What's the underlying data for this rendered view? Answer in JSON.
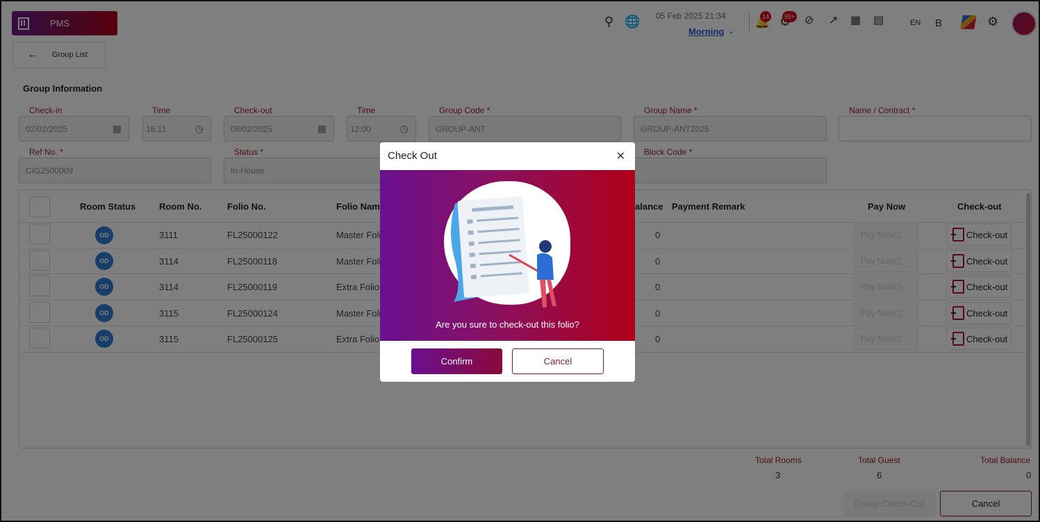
{
  "app": {
    "name": "PMS"
  },
  "header": {
    "date_time": "05 Feb 2025  21:34",
    "shift": "Morning",
    "notifications_count": "14",
    "alerts_count": "99+",
    "language": "EN",
    "b_label": "B"
  },
  "nav": {
    "back_label": "Group List"
  },
  "group_info": {
    "title": "Group Information",
    "checkin_label": "Check-in",
    "checkin_value": "02/02/2025",
    "checkin_time_label": "Time",
    "checkin_time_value": "16:11",
    "checkout_label": "Check-out",
    "checkout_value": "06/02/2025",
    "checkout_time_label": "Time",
    "checkout_time_value": "12:00",
    "group_code_label": "Group Code *",
    "group_code_value": "GROUP-ANT",
    "group_name_label": "Group Name *",
    "group_name_value": "GROUP-ANT2025",
    "name_contract_label": "Name / Contract *",
    "name_contract_value": "",
    "ref_no_label": "Ref No. *",
    "ref_no_value": "CIG2500009",
    "status_label": "Status *",
    "status_value": "In-House",
    "block_code_label": "Block Code *",
    "block_code_value": ""
  },
  "table": {
    "headers": {
      "room_status": "Room Status",
      "room_no": "Room No.",
      "folio_no": "Folio No.",
      "folio_name": "Folio Nam",
      "balance": "alance",
      "payment_remark": "Payment Remark",
      "pay_now": "Pay Now",
      "check_out": "Check-out"
    },
    "rows": [
      {
        "status": "OD",
        "room": "3111",
        "folio": "FL25000122",
        "name": "Master Foli",
        "balance": "0"
      },
      {
        "status": "OD",
        "room": "3114",
        "folio": "FL25000118",
        "name": "Master Foli",
        "balance": "0"
      },
      {
        "status": "OD",
        "room": "3114",
        "folio": "FL25000119",
        "name": "Extra Folio",
        "balance": "0"
      },
      {
        "status": "OD",
        "room": "3115",
        "folio": "FL25000124",
        "name": "Master Foli",
        "balance": "0"
      },
      {
        "status": "OD",
        "room": "3115",
        "folio": "FL25000125",
        "name": "Extra Folio",
        "balance": "0"
      }
    ],
    "pay_now_label": "Pay Now",
    "check_out_label": "Check-out"
  },
  "totals": {
    "rooms_label": "Total Rooms",
    "rooms_value": "3",
    "guest_label": "Total Guest",
    "guest_value": "6",
    "balance_label": "Total Balance",
    "balance_value": "0"
  },
  "footer": {
    "group_checkout_label": "Group Check-Out",
    "cancel_label": "Cancel"
  },
  "modal": {
    "title": "Check Out",
    "question": "Are you sure to check-out this folio?",
    "confirm_label": "Confirm",
    "cancel_label": "Cancel"
  },
  "colors": {
    "brand_purple": "#6a1090",
    "brand_red": "#b0001a",
    "accent_label": "#9b1c2e",
    "status_blue": "#2e7ad1"
  }
}
